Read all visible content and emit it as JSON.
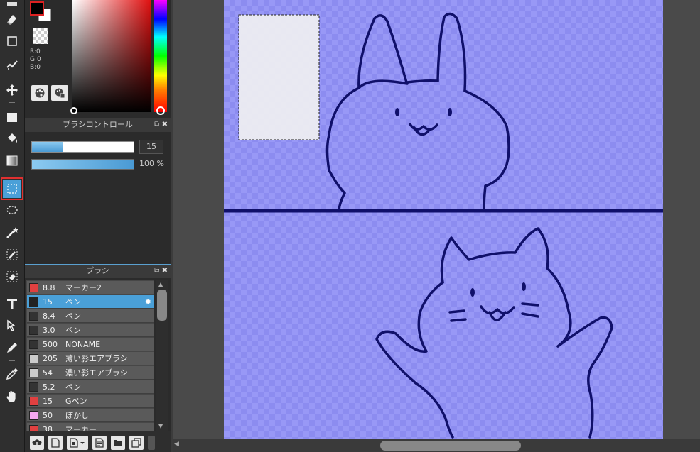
{
  "color_panel": {
    "r_label": "R:0",
    "g_label": "G:0",
    "b_label": "B:0",
    "foreground": "#000000",
    "background": "#ffffff"
  },
  "brush_control": {
    "title": "ブラシコントロール",
    "size_value": "15",
    "opacity_value": "100 %",
    "size_fraction": 0.3
  },
  "brush_panel": {
    "title": "ブラシ",
    "items": [
      {
        "size": "8.8",
        "name": "マーカー2",
        "color": "#e04040"
      },
      {
        "size": "15",
        "name": "ペン",
        "color": "#222222"
      },
      {
        "size": "8.4",
        "name": "ペン",
        "color": "#333333"
      },
      {
        "size": "3.0",
        "name": "ペン",
        "color": "#333333"
      },
      {
        "size": "500",
        "name": "NONAME",
        "color": "#333333"
      },
      {
        "size": "205",
        "name": "薄い影エアブラシ",
        "color": "#cccccc"
      },
      {
        "size": "54",
        "name": "濃い影エアブラシ",
        "color": "#cccccc"
      },
      {
        "size": "5.2",
        "name": "ペン",
        "color": "#333333"
      },
      {
        "size": "15",
        "name": "Gペン",
        "color": "#e04040"
      },
      {
        "size": "50",
        "name": "ぼかし",
        "color": "#f4a8f0"
      },
      {
        "size": "38",
        "name": "マーカー",
        "color": "#e04040"
      }
    ]
  },
  "tools": [
    "eraser-icon",
    "rectangle-icon",
    "dot-brush-icon",
    "move-icon",
    "fill-rect-icon",
    "bucket-icon",
    "gradient-icon",
    "rect-select-icon",
    "lasso-icon",
    "magic-wand-icon",
    "select-pen-icon",
    "select-eraser-icon",
    "text-icon",
    "operation-icon",
    "pen-icon",
    "eyedropper-icon",
    "hand-icon"
  ]
}
